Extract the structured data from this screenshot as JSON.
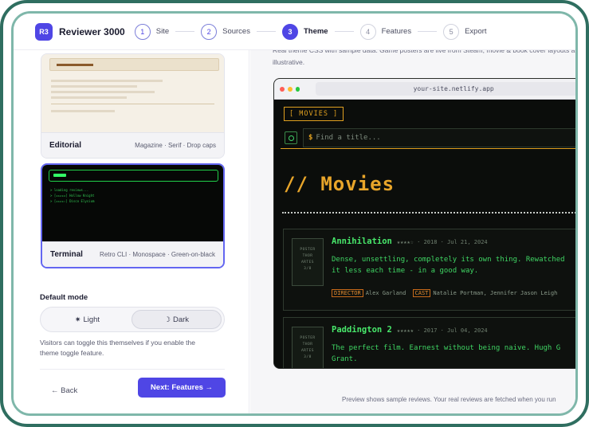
{
  "app": {
    "logo_text": "R3",
    "name": "Reviewer 3000"
  },
  "steps": [
    {
      "num": "1",
      "label": "Site"
    },
    {
      "num": "2",
      "label": "Sources"
    },
    {
      "num": "3",
      "label": "Theme"
    },
    {
      "num": "4",
      "label": "Features"
    },
    {
      "num": "5",
      "label": "Export"
    }
  ],
  "active_step": "Theme",
  "themes": [
    {
      "name": "Editorial",
      "tags": "Magazine · Serif · Drop caps"
    },
    {
      "name": "Terminal",
      "tags": "Retro CLI · Monospace · Green-on-black",
      "selected": true,
      "preview_lines": [
        "> loading reviews...",
        "> [★★★★★] Hollow Knight",
        "> [★★★★☆] Disco Elysium"
      ]
    }
  ],
  "default_mode": {
    "label": "Default mode",
    "options": [
      {
        "icon": "✷",
        "label": "Light"
      },
      {
        "icon": "☽",
        "label": "Dark"
      }
    ],
    "selected": "Dark"
  },
  "help_text": "Visitors can toggle this themselves if you enable the theme toggle feature.",
  "nav": {
    "back": "← Back",
    "next": "Next: Features →"
  },
  "preview": {
    "intro": "Real theme CSS with sample data. Game posters are live from Steam; movie & book cover layouts are illustrative.",
    "url": "your-site.netlify.app",
    "site_tag": "[ MOVIES ]",
    "search_prompt": "$",
    "search_placeholder": "Find a title...",
    "site_title": "// Movies",
    "reviews": [
      {
        "poster": [
          "POSTER",
          "THOR",
          "ARTES",
          "3/8"
        ],
        "title": "Annihilation",
        "meta": "★★★★☆ · 2018 · Jul 21, 2024",
        "text": [
          "Dense, unsettling, completely its own thing. Rewatched",
          "it less each time - in a good way."
        ],
        "credits": [
          "DIRECTOR",
          "Alex Garland",
          "CAST",
          "Natalie Portman, Jennifer Jason Leigh"
        ]
      },
      {
        "poster": [
          "POSTER",
          "THOR",
          "ARTES",
          "3/8"
        ],
        "title": "Paddington 2",
        "meta": "★★★★★ · 2017 · Jul 04, 2024",
        "text": [
          "The perfect film. Earnest without being naive. Hugh G",
          "Grant."
        ],
        "credits": []
      }
    ],
    "footnote": "Preview shows sample reviews. Your real reviews are fetched when you run"
  }
}
